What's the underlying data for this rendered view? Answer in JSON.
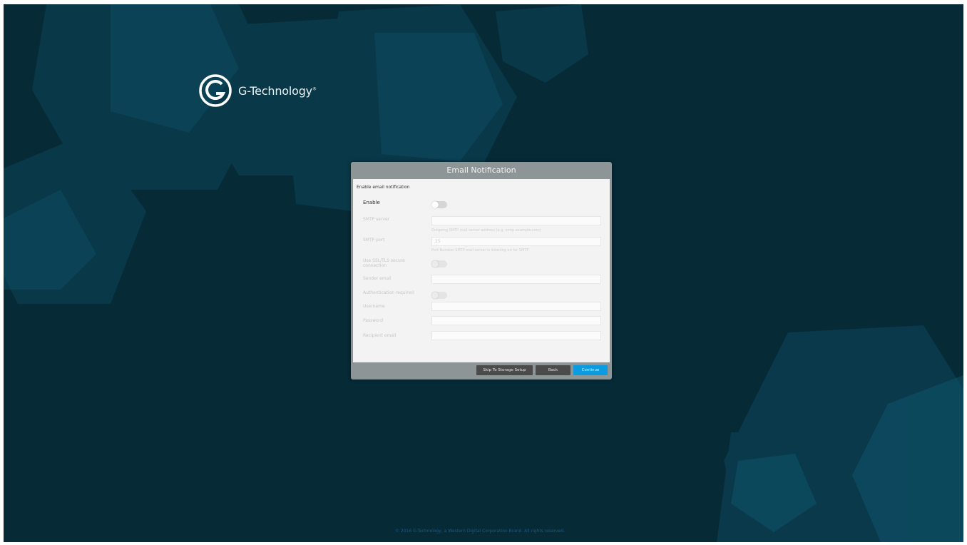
{
  "brand": {
    "name": "G-Technology",
    "trademark": "®"
  },
  "dialog": {
    "title": "Email Notification",
    "section_title": "Enable email notification",
    "enable_label": "Enable",
    "fields": {
      "smtp_server_label": "SMTP server",
      "smtp_server_value": "",
      "smtp_server_hint": "Outgoing SMTP mail server address (e.g. smtp.example.com)",
      "smtp_port_label": "SMTP port",
      "smtp_port_value": "25",
      "smtp_port_hint": "Port Number SMTP mail server is listening on for SMTP",
      "ssl_tls_label_line1": "Use SSL/TLS secure",
      "ssl_tls_label_line2": "connection",
      "sender_label": "Sender email",
      "sender_value": "",
      "auth_label": "Authentication required",
      "username_label": "Username",
      "username_value": "",
      "password_label": "Password",
      "password_value": "",
      "recipient_label": "Recipient email",
      "recipient_value": ""
    },
    "buttons": {
      "skip": "Skip To Storage Setup",
      "back": "Back",
      "continue": "Continue"
    }
  },
  "footer": {
    "copyright": "© 2016 G-Technology, a Western Digital Corporation Brand. All rights reserved."
  },
  "colors": {
    "background": "#062a36",
    "accent": "#0a9be0",
    "dialog_frame": "#8e9597"
  }
}
